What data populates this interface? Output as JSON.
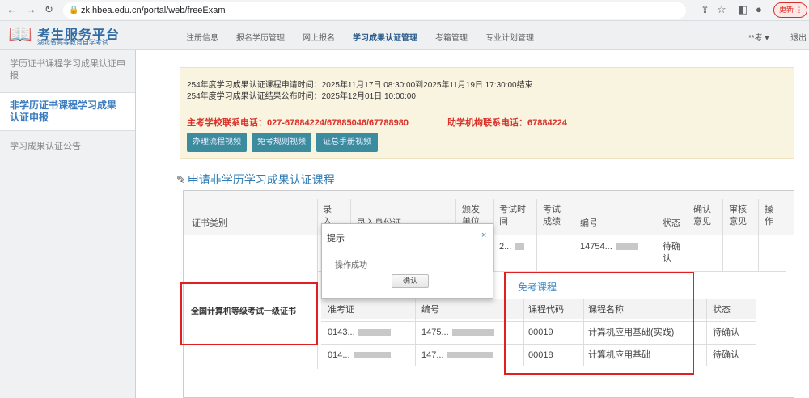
{
  "browser": {
    "url": "zk.hbea.edu.cn/portal/web/freeExam",
    "update_label": "更新"
  },
  "site": {
    "title": "考生服务平台",
    "subtitle": "湖北省高等教育自学考试",
    "nav": [
      "注册信息",
      "报名学历管理",
      "网上报名",
      "学习成果认证管理",
      "考籍管理",
      "专业计划管理"
    ],
    "active_nav_index": 3,
    "user": "**考 ▾",
    "logout": "退出"
  },
  "sidebar": {
    "items": [
      {
        "label": "学历证书课程学习成果认证申报",
        "active": false
      },
      {
        "label": "非学历证书课程学习成果认证申报",
        "active": true
      },
      {
        "label": "学习成果认证公告",
        "active": false
      }
    ]
  },
  "notice": {
    "line1": "254年度学习成果认证课程申请时间：2025年11月17日 08:30:00到2025年11月19日 17:30:00结束",
    "line2": "254年度学习成果认证结果公布时间：2025年12月01日 10:00:00",
    "phone_main": "主考学校联系电话：027-67884224/67885046/67788980",
    "phone_agency": "助学机构联系电话：67884224",
    "buttons": [
      "办理流程视频",
      "免考规则视频",
      "证总手册视频"
    ]
  },
  "section_title": "申请非学历学习成果认证课程",
  "table": {
    "headers": [
      "证书类别",
      "录入姓名",
      "录入身份证",
      "颁发单位",
      "考试时间",
      "考试成绩",
      "编号",
      "状态",
      "确认意见",
      "审核意见",
      "操作"
    ],
    "row": {
      "exam_time": "2...",
      "number": "14754...",
      "status": "待确认",
      "certificate_type": "全国计算机等级考试一级证书"
    },
    "sub_left": {
      "headers": [
        "准考证",
        "编号"
      ],
      "rows": [
        {
          "admission": "0143...",
          "number": "1475..."
        },
        {
          "admission": "014...",
          "number": "147..."
        }
      ]
    },
    "exempt_title": "免考课程",
    "exempt": {
      "headers": [
        "课程代码",
        "课程名称",
        "状态"
      ],
      "rows": [
        {
          "code": "00019",
          "name": "计算机应用基础(实践)",
          "status": "待确认"
        },
        {
          "code": "00018",
          "name": "计算机应用基础",
          "status": "待确认"
        }
      ]
    }
  },
  "dialog": {
    "title": "提示",
    "close": "×",
    "message": "操作成功",
    "ok": "确认"
  }
}
